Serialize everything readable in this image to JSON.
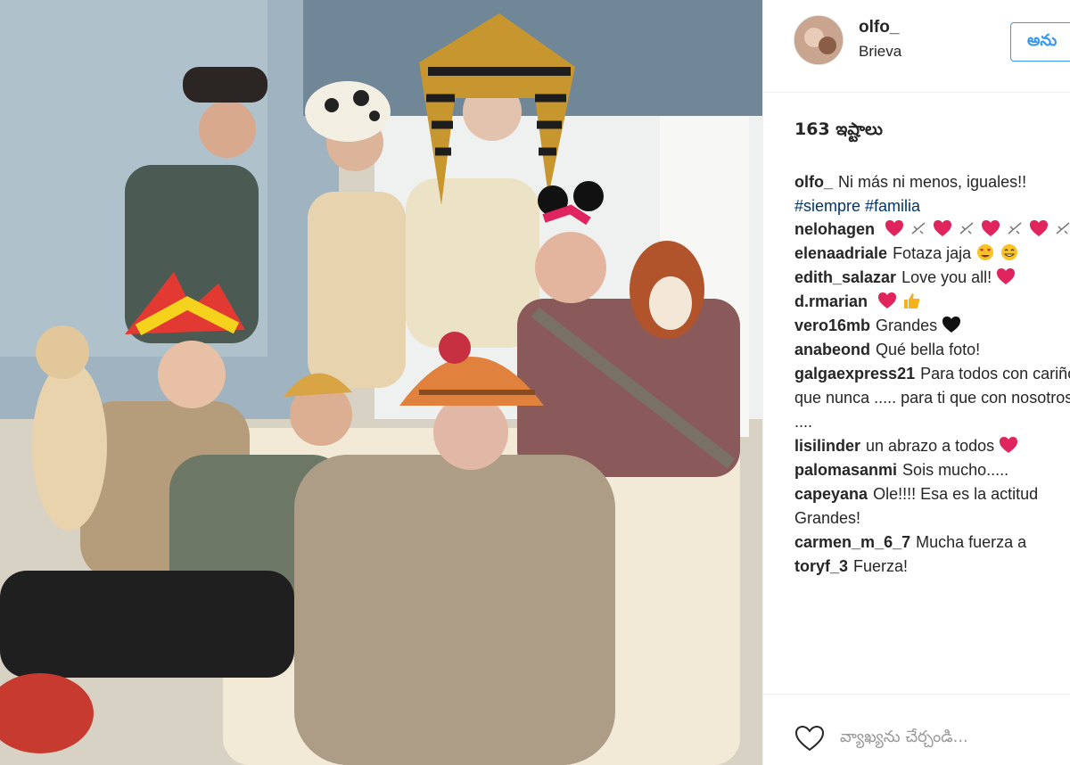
{
  "post": {
    "photo_description": "",
    "photo_label": ""
  },
  "header": {
    "username": "olfo_",
    "location": "Brieva",
    "follow_label": "అను"
  },
  "likes_text": "163 ఇష్టాలు",
  "caption": {
    "user": "olfo_",
    "text": "Ni más ni menos, iguales!!",
    "tags": "#siempre #familia"
  },
  "comments": [
    {
      "user": "nelohagen",
      "text": "",
      "icons": [
        "heart-icon",
        "sparkle-icon",
        "heart-icon",
        "sparkle-icon",
        "heart-icon",
        "sparkle-icon",
        "heart-icon",
        "sparkle-icon"
      ]
    },
    {
      "user": "elenaadriale",
      "text": "Fotaza jaja",
      "icons": [
        "heart-eyes-emoji-icon",
        "grin-emoji-icon"
      ]
    },
    {
      "user": "edith_salazar",
      "text": "Love you all!",
      "icons": [
        "heart-icon"
      ]
    },
    {
      "user": "d.rmarian",
      "text": "",
      "icons": [
        "heart-icon",
        "thumbs-up-icon"
      ]
    },
    {
      "user": "vero16mb",
      "text": "Grandes",
      "icons": [
        "black-heart-icon"
      ]
    },
    {
      "user": "anabeond",
      "text": "Qué bella foto!",
      "icons": []
    },
    {
      "user": "galgaexpress21",
      "text": "Para todos con cariño que nunca ..... para ti que con nosotros ....",
      "icons": []
    },
    {
      "user": "lisilinder",
      "text": "un abrazo a todos",
      "icons": [
        "heart-icon"
      ]
    },
    {
      "user": "palomasanmi",
      "text": "Sois mucho.....",
      "icons": []
    },
    {
      "user": "capeyana",
      "text": "Ole!!!! Esa es la actitud Grandes!",
      "icons": []
    },
    {
      "user": "carmen_m_6_7",
      "text": "Mucha fuerza a",
      "icons": []
    },
    {
      "user": "toryf_3",
      "text": "Fuerza!",
      "icons": []
    }
  ],
  "footer": {
    "add_comment_placeholder": "వ్యాఖ్యను చేర్చండి...",
    "like_icon": "heart-outline-icon"
  },
  "colors": {
    "link": "#003569",
    "follow_blue": "#3897f0",
    "heart_red": "#e0245e",
    "divider": "#efefef"
  }
}
